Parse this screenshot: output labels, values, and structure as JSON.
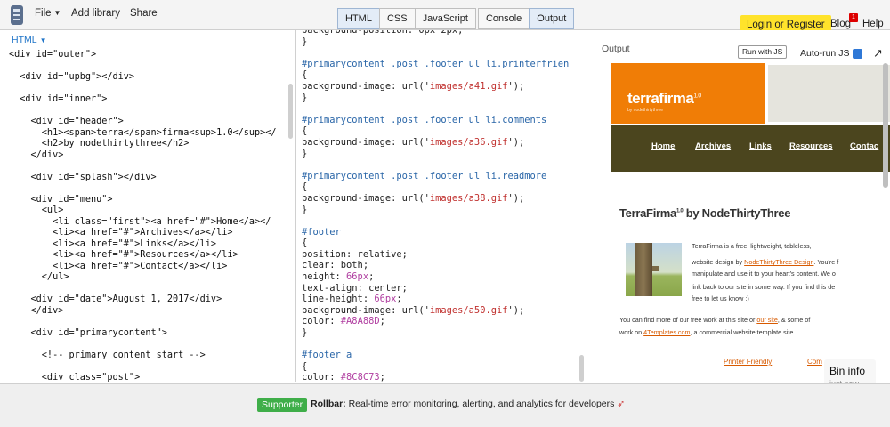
{
  "toolbar": {
    "file_label": "File",
    "add_library_label": "Add library",
    "share_label": "Share",
    "tabs": [
      "HTML",
      "CSS",
      "JavaScript",
      "Console",
      "Output"
    ],
    "login_label": "Login or Register",
    "blog_label": "Blog",
    "blog_badge": "1",
    "help_label": "Help"
  },
  "html_panel": {
    "label": "HTML",
    "lines": [
      "<div id=\"outer\">",
      "",
      "  <div id=\"upbg\"></div>",
      "",
      "  <div id=\"inner\">",
      "",
      "    <div id=\"header\">",
      "      <h1><span>terra</span>firma<sup>1.0</sup></",
      "      <h2>by nodethirtythree</h2>",
      "    </div>",
      "",
      "    <div id=\"splash\"></div>",
      "",
      "    <div id=\"menu\">",
      "      <ul>",
      "        <li class=\"first\"><a href=\"#\">Home</a></",
      "        <li><a href=\"#\">Archives</a></li>",
      "        <li><a href=\"#\">Links</a></li>",
      "        <li><a href=\"#\">Resources</a></li>",
      "        <li><a href=\"#\">Contact</a></li>",
      "      </ul>",
      "",
      "    <div id=\"date\">August 1, 2017</div>",
      "    </div>",
      "",
      "    <div id=\"primarycontent\">",
      "",
      "      <!-- primary content start -->",
      "",
      "      <div class=\"post\">"
    ]
  },
  "css_panel": {
    "lines": [
      {
        "t": "background-position: 0px 2px;"
      },
      {
        "t": "}"
      },
      {
        "t": ""
      },
      {
        "t": "#primarycontent .post .footer ul li.printerfrien",
        "c": "sel"
      },
      {
        "t": "{"
      },
      {
        "t": "background-image: url('images/a41.gif');",
        "s": "images/a41.gif"
      },
      {
        "t": "}"
      },
      {
        "t": ""
      },
      {
        "t": "#primarycontent .post .footer ul li.comments",
        "c": "sel"
      },
      {
        "t": "{"
      },
      {
        "t": "background-image: url('images/a36.gif');",
        "s": "images/a36.gif"
      },
      {
        "t": "}"
      },
      {
        "t": ""
      },
      {
        "t": "#primarycontent .post .footer ul li.readmore",
        "c": "sel"
      },
      {
        "t": "{"
      },
      {
        "t": "background-image: url('images/a38.gif');",
        "s": "images/a38.gif"
      },
      {
        "t": "}"
      },
      {
        "t": ""
      },
      {
        "t": "#footer",
        "c": "sel"
      },
      {
        "t": "{"
      },
      {
        "t": "position: relative;"
      },
      {
        "t": "clear: both;"
      },
      {
        "t": "height: 66px;",
        "n": "66px"
      },
      {
        "t": "text-align: center;"
      },
      {
        "t": "line-height: 66px;",
        "n": "66px"
      },
      {
        "t": "background-image: url('images/a50.gif');",
        "s": "images/a50.gif"
      },
      {
        "t": "color: #A8A88D;",
        "n": "#A8A88D"
      },
      {
        "t": "}"
      },
      {
        "t": ""
      },
      {
        "t": "#footer a",
        "c": "sel"
      },
      {
        "t": "{"
      },
      {
        "t": "color: #8C8C73;",
        "n": "#8C8C73"
      }
    ]
  },
  "output_panel": {
    "label": "Output",
    "run_label": "Run with JS",
    "autorun_label": "Auto-run JS",
    "site": {
      "logo_text": "terrafirma",
      "logo_version": "1.0",
      "tagline": "by nodethirtythree",
      "nav": [
        "Home",
        "Archives",
        "Links",
        "Resources",
        "Contac"
      ],
      "post_title": "TerraFirma",
      "post_title_version": "1.0",
      "post_title_suffix": " by NodeThirtyThree",
      "para1": [
        "TerraFirma",
        " is a free, lightweight, tableless,",
        "website design by ",
        "NodeThirtyThree Design",
        ". You're f",
        "manipulate and use it to your heart's content. We o",
        "link back to our site in some way. If you find this de",
        "free to let us know :)"
      ],
      "para2": [
        "You can find more of our free work at this site or ",
        "our site",
        ", & some of",
        "work on ",
        "4Templates.com",
        ", a commercial website template site."
      ],
      "footer_links": [
        "Printer Friendly",
        "Com"
      ]
    },
    "bin_info_title": "Bin info",
    "bin_info_sub": "just now"
  },
  "bottom": {
    "supporter_label": "Supporter",
    "rollbar_brand": "Rollbar:",
    "rollbar_text": " Real-time error monitoring, alerting, and analytics for developers"
  },
  "colors": {
    "accent_yellow": "#ffe32b",
    "site_orange": "#f07d06",
    "site_nav": "#4b451e",
    "supporter_green": "#3fae49"
  }
}
